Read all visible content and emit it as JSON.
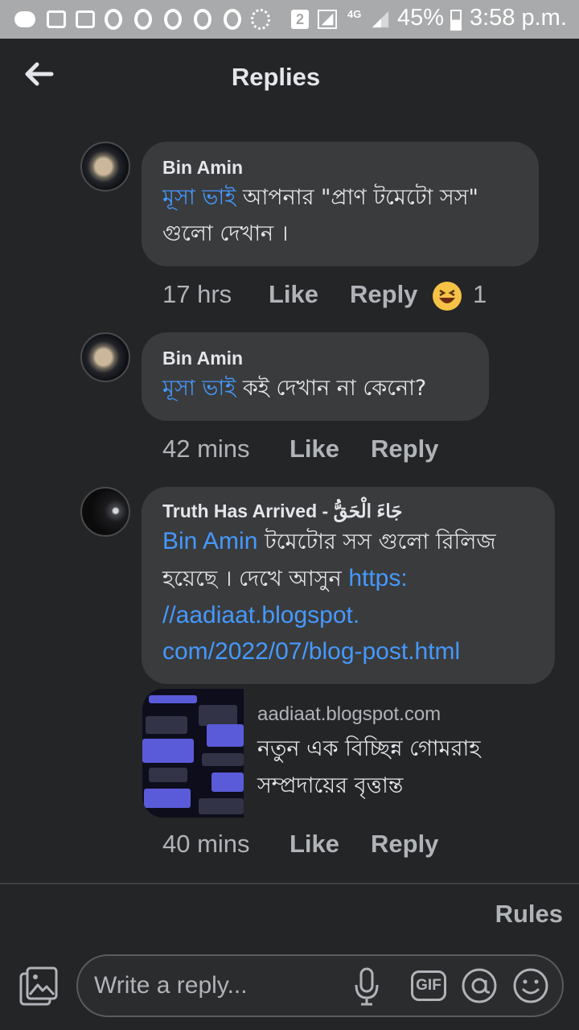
{
  "status_bar": {
    "battery": "45%",
    "time": "3:58 p.m.",
    "sim_badge": "2",
    "network": "4G"
  },
  "header": {
    "title": "Replies"
  },
  "comments": [
    {
      "author": "Bin Amin",
      "mention": "মূসা ভাই",
      "text_line1": " আপনার \"প্রাণ টমেটো সস\"",
      "text_line2": "গুলো দেখান ।",
      "time": "17 hrs",
      "like": "Like",
      "reply": "Reply",
      "reaction_count": "1",
      "reaction_icon": "laughing-emoji"
    },
    {
      "author": "Bin Amin",
      "mention": "মূসা ভাই",
      "text_line1": " কই দেখান না কেনো?",
      "time": "42 mins",
      "like": "Like",
      "reply": "Reply"
    },
    {
      "author": "Truth Has Arrived - جَاءَ الْحَقُّ",
      "mention": "Bin Amin",
      "text_line1": " টমেটোর সস গুলো রিলিজ",
      "text_line2": "হয়েছে । দেখে আসুন ",
      "link_part1": "https:",
      "link_part2": "//aadiaat.blogspot.",
      "link_part3": "com/2022/07/blog-post.html",
      "preview": {
        "domain": "aadiaat.blogspot.com",
        "title_line1": "নতুন এক বিচ্ছিন্ন গোমরাহ",
        "title_line2": "সম্প্রদায়ের বৃত্তান্ত"
      },
      "time": "40 mins",
      "like": "Like",
      "reply": "Reply"
    }
  ],
  "footer": {
    "rules": "Rules",
    "reply_placeholder": "Write a reply...",
    "gif_label": "GIF"
  },
  "colors": {
    "background": "#242526",
    "bubble": "#3a3b3c",
    "link": "#4599ff",
    "status_bar": "#a9aaab"
  }
}
